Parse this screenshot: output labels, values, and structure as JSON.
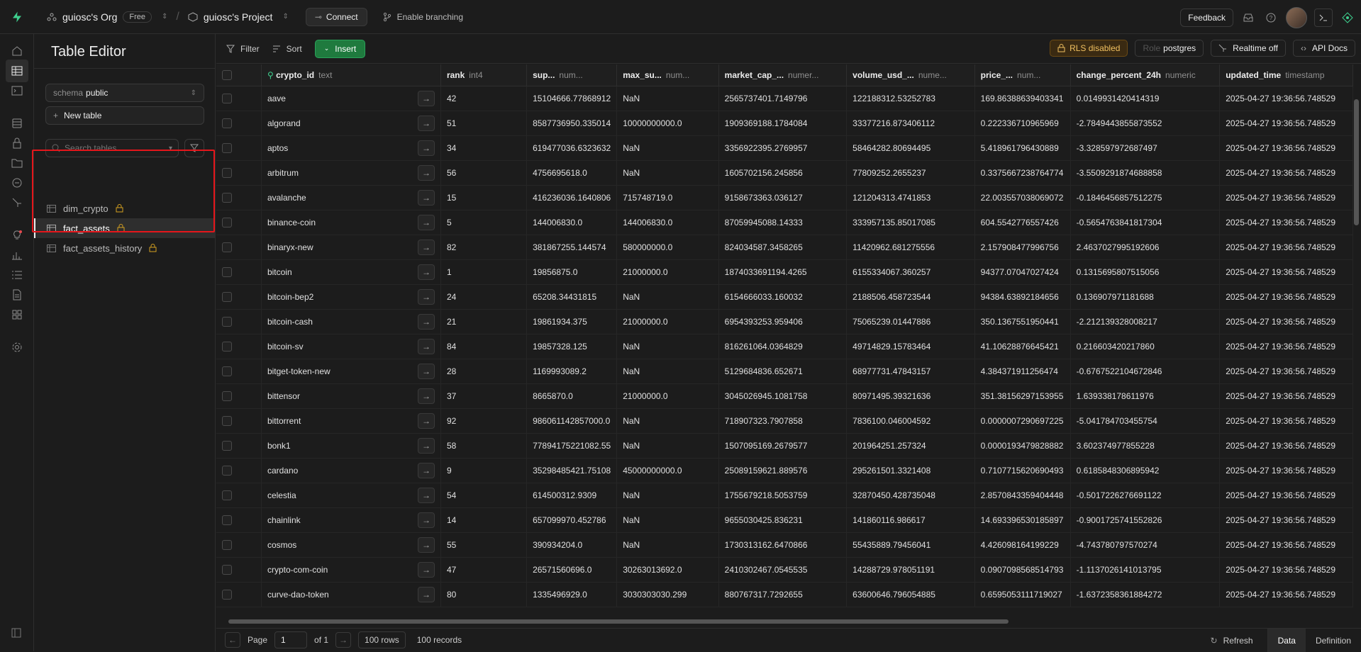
{
  "topbar": {
    "org_name": "guiosc's Org",
    "plan": "Free",
    "project_name": "guiosc's Project",
    "connect_label": "Connect",
    "branching_label": "Enable branching",
    "feedback_label": "Feedback"
  },
  "panel": {
    "title": "Table Editor",
    "schema_label": "schema",
    "schema_value": "public",
    "new_table_label": "New table",
    "search_placeholder": "Search tables...",
    "tables": [
      {
        "name": "dim_crypto",
        "active": false
      },
      {
        "name": "fact_assets",
        "active": true
      },
      {
        "name": "fact_assets_history",
        "active": false
      }
    ]
  },
  "toolbar": {
    "filter_label": "Filter",
    "sort_label": "Sort",
    "insert_label": "Insert",
    "rls_label": "RLS disabled",
    "role_prefix": "Role",
    "role_value": "postgres",
    "realtime_label": "Realtime off",
    "api_docs_label": "API Docs"
  },
  "columns": [
    {
      "name": "crypto_id",
      "type": "text"
    },
    {
      "name": "rank",
      "type": "int4"
    },
    {
      "name": "sup...",
      "type": "num..."
    },
    {
      "name": "max_su...",
      "type": "num..."
    },
    {
      "name": "market_cap_...",
      "type": "numer..."
    },
    {
      "name": "volume_usd_...",
      "type": "nume..."
    },
    {
      "name": "price_...",
      "type": "num..."
    },
    {
      "name": "change_percent_24h",
      "type": "numeric"
    },
    {
      "name": "updated_time",
      "type": "timestamp"
    }
  ],
  "rows": [
    [
      "aave",
      "42",
      "15104666.77868912",
      "NaN",
      "2565737401.7149796",
      "122188312.53252783",
      "169.86388639403341",
      "0.0149931420414319",
      "2025-04-27 19:36:56.748529"
    ],
    [
      "algorand",
      "51",
      "8587736950.335014",
      "10000000000.0",
      "1909369188.1784084",
      "33377216.873406112",
      "0.222336710965969",
      "-2.7849443855873552",
      "2025-04-27 19:36:56.748529"
    ],
    [
      "aptos",
      "34",
      "619477036.6323632",
      "NaN",
      "3356922395.2769957",
      "58464282.80694495",
      "5.418961796430889",
      "-3.328597972687497",
      "2025-04-27 19:36:56.748529"
    ],
    [
      "arbitrum",
      "56",
      "4756695618.0",
      "NaN",
      "1605702156.245856",
      "77809252.2655237",
      "0.3375667238764774",
      "-3.5509291874688858",
      "2025-04-27 19:36:56.748529"
    ],
    [
      "avalanche",
      "15",
      "416236036.1640806",
      "715748719.0",
      "9158673363.036127",
      "121204313.4741853",
      "22.003557038069072",
      "-0.1846456857512275",
      "2025-04-27 19:36:56.748529"
    ],
    [
      "binance-coin",
      "5",
      "144006830.0",
      "144006830.0",
      "87059945088.14333",
      "333957135.85017085",
      "604.5542776557426",
      "-0.5654763841817304",
      "2025-04-27 19:36:56.748529"
    ],
    [
      "binaryx-new",
      "82",
      "381867255.144574",
      "580000000.0",
      "824034587.3458265",
      "11420962.681275556",
      "2.157908477996756",
      "2.4637027995192606",
      "2025-04-27 19:36:56.748529"
    ],
    [
      "bitcoin",
      "1",
      "19856875.0",
      "21000000.0",
      "1874033691194.4265",
      "6155334067.360257",
      "94377.07047027424",
      "0.1315695807515056",
      "2025-04-27 19:36:56.748529"
    ],
    [
      "bitcoin-bep2",
      "24",
      "65208.34431815",
      "NaN",
      "6154666033.160032",
      "2188506.458723544",
      "94384.63892184656",
      "0.136907971181688",
      "2025-04-27 19:36:56.748529"
    ],
    [
      "bitcoin-cash",
      "21",
      "19861934.375",
      "21000000.0",
      "6954393253.959406",
      "75065239.01447886",
      "350.1367551950441",
      "-2.212139328008217",
      "2025-04-27 19:36:56.748529"
    ],
    [
      "bitcoin-sv",
      "84",
      "19857328.125",
      "NaN",
      "816261064.0364829",
      "49714829.15783464",
      "41.10628876645421",
      "0.216603420217860",
      "2025-04-27 19:36:56.748529"
    ],
    [
      "bitget-token-new",
      "28",
      "1169993089.2",
      "NaN",
      "5129684836.652671",
      "68977731.47843157",
      "4.384371911256474",
      "-0.6767522104672846",
      "2025-04-27 19:36:56.748529"
    ],
    [
      "bittensor",
      "37",
      "8665870.0",
      "21000000.0",
      "3045026945.1081758",
      "80971495.39321636",
      "351.38156297153955",
      "1.639338178611976",
      "2025-04-27 19:36:56.748529"
    ],
    [
      "bittorrent",
      "92",
      "986061142857000.0",
      "NaN",
      "718907323.7907858",
      "7836100.046004592",
      "0.0000007290697225",
      "-5.041784703455754",
      "2025-04-27 19:36:56.748529"
    ],
    [
      "bonk1",
      "58",
      "77894175221082.55",
      "NaN",
      "1507095169.2679577",
      "201964251.257324",
      "0.0000193479828882",
      "3.602374977855228",
      "2025-04-27 19:36:56.748529"
    ],
    [
      "cardano",
      "9",
      "35298485421.75108",
      "45000000000.0",
      "25089159621.889576",
      "295261501.3321408",
      "0.7107715620690493",
      "0.6185848306895942",
      "2025-04-27 19:36:56.748529"
    ],
    [
      "celestia",
      "54",
      "614500312.9309",
      "NaN",
      "1755679218.5053759",
      "32870450.428735048",
      "2.8570843359404448",
      "-0.5017226276691122",
      "2025-04-27 19:36:56.748529"
    ],
    [
      "chainlink",
      "14",
      "657099970.452786",
      "NaN",
      "9655030425.836231",
      "141860116.986617",
      "14.693396530185897",
      "-0.9001725741552826",
      "2025-04-27 19:36:56.748529"
    ],
    [
      "cosmos",
      "55",
      "390934204.0",
      "NaN",
      "1730313162.6470866",
      "55435889.79456041",
      "4.426098164199229",
      "-4.743780797570274",
      "2025-04-27 19:36:56.748529"
    ],
    [
      "crypto-com-coin",
      "47",
      "26571560696.0",
      "30263013692.0",
      "2410302467.0545535",
      "14288729.978051191",
      "0.0907098568514793",
      "-1.1137026141013795",
      "2025-04-27 19:36:56.748529"
    ],
    [
      "curve-dao-token",
      "80",
      "1335496929.0",
      "3030303030.299",
      "880767317.7292655",
      "63600646.796054885",
      "0.6595053111719027",
      "-1.6372358361884272",
      "2025-04-27 19:36:56.748529"
    ]
  ],
  "footer": {
    "page_label": "Page",
    "page_value": "1",
    "of_label": "of 1",
    "rows_label": "100 rows",
    "records_label": "100 records",
    "refresh_label": "Refresh",
    "data_tab": "Data",
    "definition_tab": "Definition"
  },
  "colors": {
    "accent": "#3ecf8e",
    "insert_green": "#1f7a3e",
    "rls_amber": "#f0c060",
    "highlight_red": "#e5161b"
  }
}
